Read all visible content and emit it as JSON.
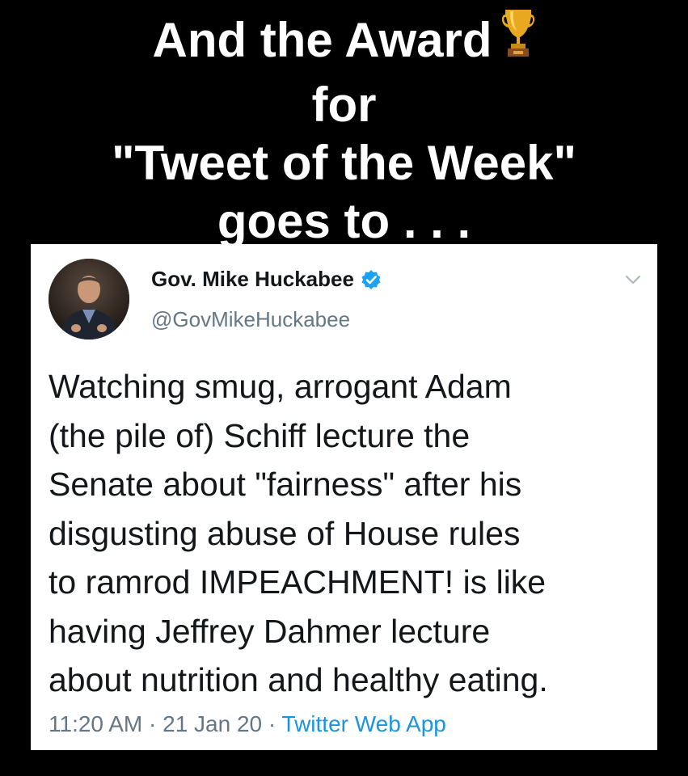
{
  "headline": {
    "line1": "And the Award",
    "line2": "for",
    "line3": "\"Tweet of the Week\"",
    "line4": "goes to . . .",
    "trophy_icon": "trophy-icon"
  },
  "tweet": {
    "display_name": "Gov. Mike Huckabee",
    "handle": "@GovMikeHuckabee",
    "verified_icon": "verified-badge-icon",
    "menu_icon": "chevron-down-icon",
    "text_lines": [
      "Watching smug, arrogant Adam",
      "(the pile of) Schiff lecture the",
      "Senate about \"fairness\" after his",
      "disgusting abuse of House rules",
      "to ramrod IMPEACHMENT! is like",
      "having Jeffrey Dahmer lecture",
      "about nutrition and healthy eating."
    ],
    "time": "11:20 AM",
    "date": "21 Jan 20",
    "separator": "·",
    "source": "Twitter Web App"
  },
  "colors": {
    "background": "#000000",
    "headline_text": "#ffffff",
    "card_background": "#ffffff",
    "tweet_text": "#14171a",
    "secondary_text": "#657786",
    "link_blue": "#1b95e0",
    "verified_blue": "#1da1f2"
  }
}
